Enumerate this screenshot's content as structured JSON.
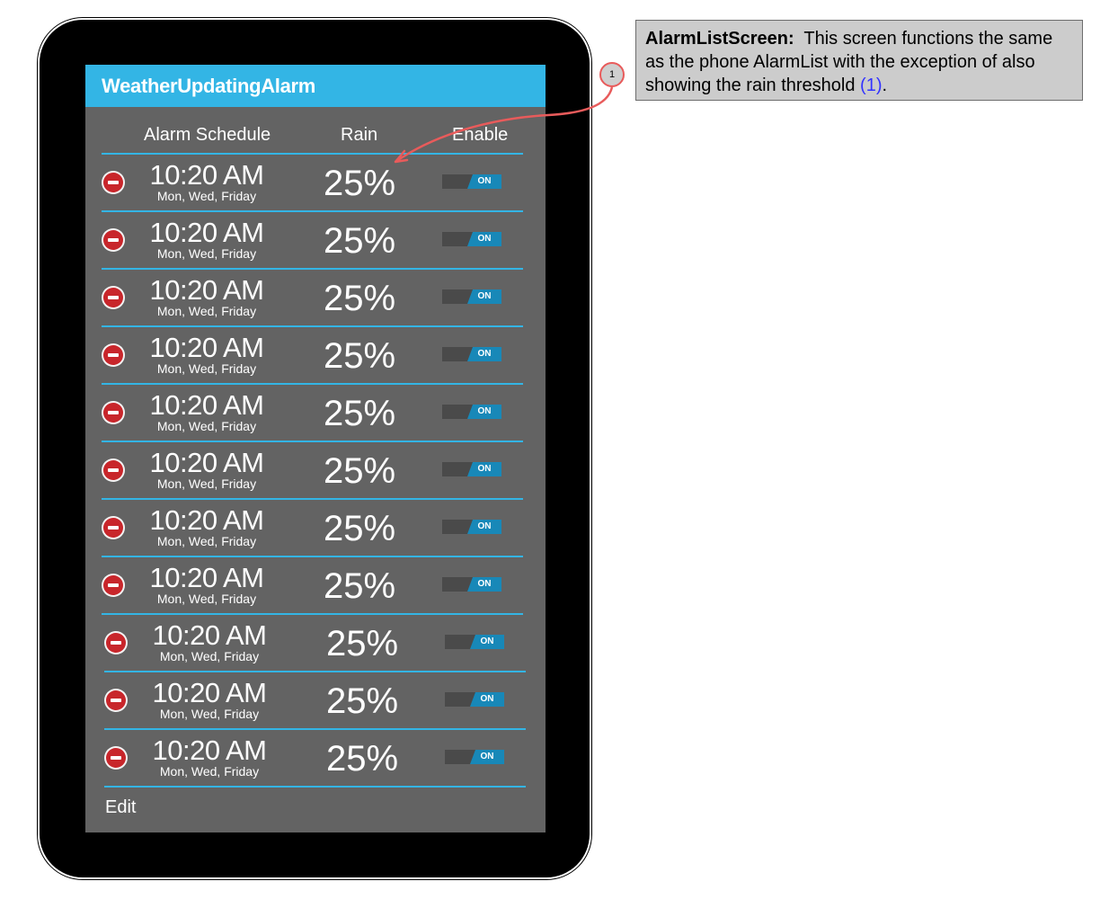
{
  "app": {
    "title": "WeatherUpdatingAlarm"
  },
  "columns": {
    "schedule": "Alarm Schedule",
    "rain": "Rain",
    "enable": "Enable"
  },
  "alarms": [
    {
      "time": "10:20 AM",
      "days": "Mon, Wed, Friday",
      "rain": "25%",
      "toggle": "ON"
    },
    {
      "time": "10:20 AM",
      "days": "Mon, Wed, Friday",
      "rain": "25%",
      "toggle": "ON"
    },
    {
      "time": "10:20 AM",
      "days": "Mon, Wed, Friday",
      "rain": "25%",
      "toggle": "ON"
    },
    {
      "time": "10:20 AM",
      "days": "Mon, Wed, Friday",
      "rain": "25%",
      "toggle": "ON"
    },
    {
      "time": "10:20 AM",
      "days": "Mon, Wed, Friday",
      "rain": "25%",
      "toggle": "ON"
    },
    {
      "time": "10:20 AM",
      "days": "Mon, Wed, Friday",
      "rain": "25%",
      "toggle": "ON"
    },
    {
      "time": "10:20 AM",
      "days": "Mon, Wed, Friday",
      "rain": "25%",
      "toggle": "ON"
    },
    {
      "time": "10:20 AM",
      "days": "Mon, Wed, Friday",
      "rain": "25%",
      "toggle": "ON"
    },
    {
      "time": "10:20 AM",
      "days": "Mon, Wed, Friday",
      "rain": "25%",
      "toggle": "ON"
    },
    {
      "time": "10:20 AM",
      "days": "Mon, Wed, Friday",
      "rain": "25%",
      "toggle": "ON"
    },
    {
      "time": "10:20 AM",
      "days": "Mon, Wed, Friday",
      "rain": "25%",
      "toggle": "ON"
    }
  ],
  "footer": {
    "edit_label": "Edit"
  },
  "annotation": {
    "marker": "1",
    "title": "AlarmListScreen:",
    "text": "This screen functions the same as the phone AlarmList with the exception of also showing the rain threshold",
    "ref": "(1)",
    "end": "."
  },
  "colors": {
    "accent": "#33b5e5",
    "screen_bg": "#636363",
    "delete": "#c8262b",
    "toggle_on": "#1888b8",
    "callout": "#e85b5b"
  },
  "icons": {
    "delete": "minus-circle-icon"
  }
}
